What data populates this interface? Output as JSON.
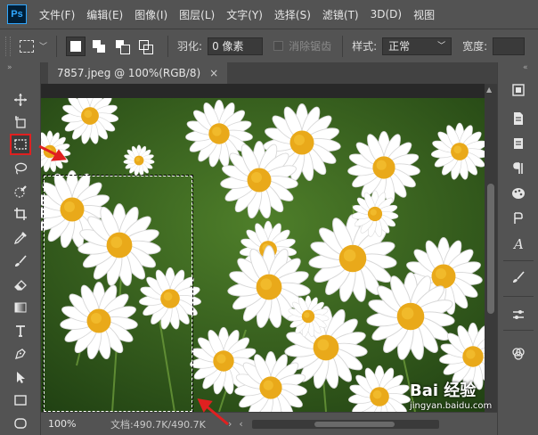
{
  "app": {
    "logo": "Ps"
  },
  "menu": [
    "文件(F)",
    "编辑(E)",
    "图像(I)",
    "图层(L)",
    "文字(Y)",
    "选择(S)",
    "滤镜(T)",
    "3D(D)",
    "视图"
  ],
  "options": {
    "feather_label": "羽化:",
    "feather_value": "0 像素",
    "antialias_label": "消除锯齿",
    "style_label": "样式:",
    "style_value": "正常",
    "width_label": "宽度:"
  },
  "document": {
    "tab_title": "7857.jpeg @ 100%(RGB/8)",
    "close": "×"
  },
  "status": {
    "zoom": "100%",
    "doc_info": "文档:490.7K/490.7K"
  },
  "tools": [
    "move-icon",
    "artboard-icon",
    "rectangular-marquee-icon",
    "lasso-icon",
    "quick-selection-icon",
    "crop-icon",
    "eyedropper-icon",
    "brush-icon",
    "eraser-icon",
    "gradient-icon",
    "type-icon",
    "pen-icon",
    "path-selection-icon",
    "rectangle-shape-icon",
    "ellipse-shape-icon"
  ],
  "watermark": {
    "text": "Bai 经验",
    "url": "jingyan.baidu.com"
  },
  "colors": {
    "ui_bg": "#535353",
    "annotation_red": "#e02020",
    "ps_blue": "#31a8ff"
  }
}
